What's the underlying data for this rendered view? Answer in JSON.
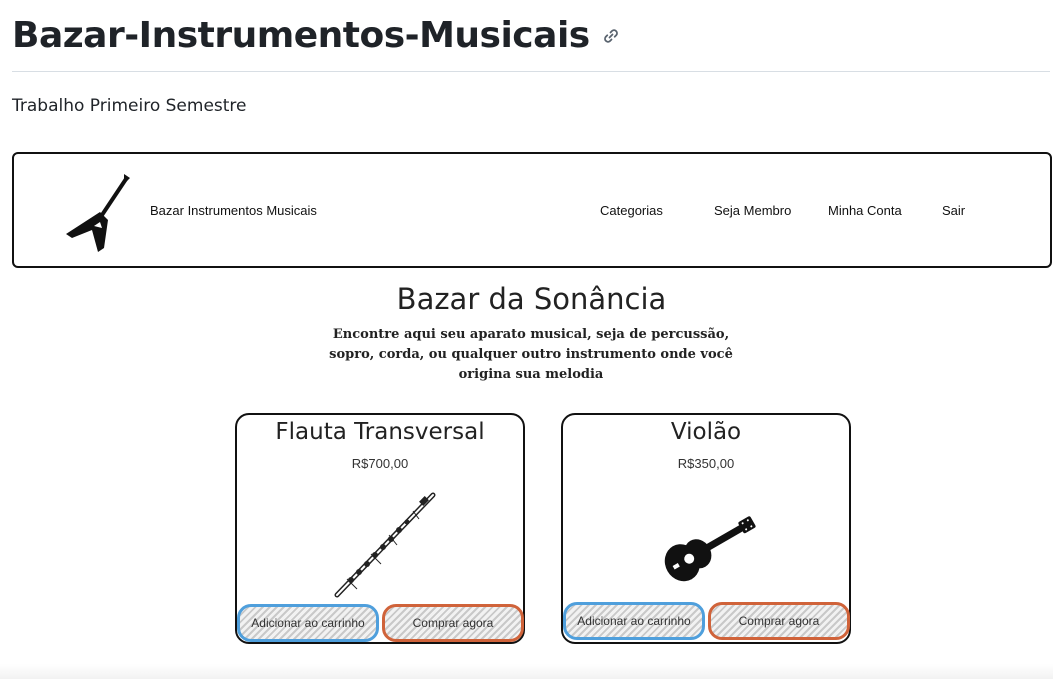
{
  "readme": {
    "title": "Bazar-Instrumentos-Musicais",
    "subtitle": "Trabalho Primeiro Semestre",
    "anchor_icon": "link-icon"
  },
  "navbar": {
    "brand": "Bazar Instrumentos Musicais",
    "logo_icon": "electric-guitar-logo",
    "links": [
      "Categorias",
      "Seja Membro",
      "Minha Conta",
      "Sair"
    ]
  },
  "hero": {
    "title": "Bazar da Sonância",
    "description": "Encontre aqui seu aparato musical, seja de percussão, sopro, corda, ou qualquer outro instrumento onde você origina sua melodia"
  },
  "products": [
    {
      "name": "Flauta Transversal",
      "price": "R$700,00",
      "image_icon": "flute-image",
      "add_label": "Adicionar ao carrinho",
      "buy_label": "Comprar agora"
    },
    {
      "name": "Violão",
      "price": "R$350,00",
      "image_icon": "acoustic-guitar-image",
      "add_label": "Adicionar ao carrinho",
      "buy_label": "Comprar agora"
    }
  ],
  "colors": {
    "cart_border": "#4f9fdc",
    "buy_border": "#d0633a"
  }
}
